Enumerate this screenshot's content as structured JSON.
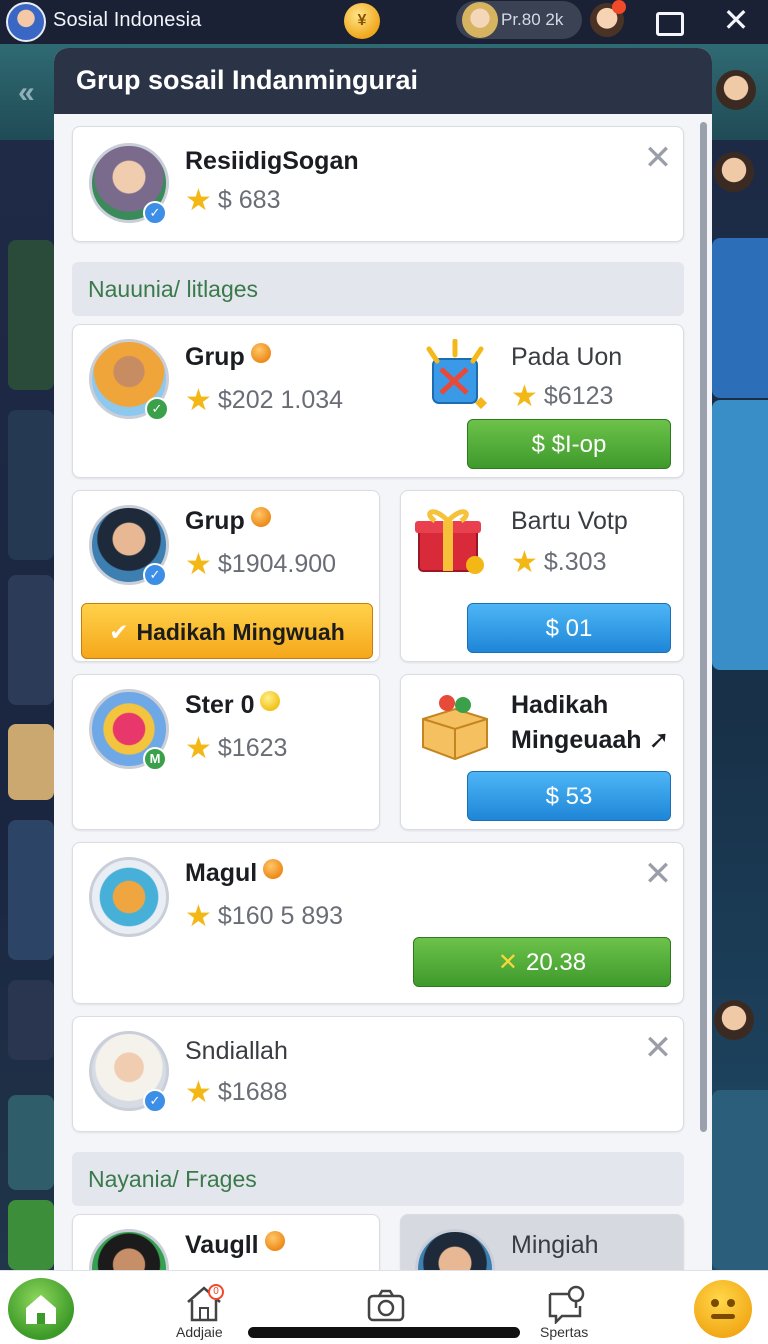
{
  "topbar": {
    "app_title": "Sosial Indonesia",
    "profile_pill_text": "Pr.80 2k"
  },
  "modal": {
    "title": "Grup sosail Indanmingurai"
  },
  "featured": {
    "name": "ResiidigSogan",
    "value": "$ 683"
  },
  "sections": {
    "first": "Nauunia/ litlages",
    "second": "Nayania/ Frages"
  },
  "cards": {
    "grup1": {
      "name": "Grup",
      "value": "$202 1.034"
    },
    "pada": {
      "name": "Pada Uon",
      "value": "$6123",
      "button": "$ $I-op"
    },
    "grup2": {
      "name": "Grup",
      "value": "$1904.900",
      "button": "Hadikah Mingwuah"
    },
    "gartu": {
      "name": "Bartu Votp",
      "value": "$.303",
      "button": "$ 01"
    },
    "ster": {
      "name": "Ster 0",
      "value": "$1623"
    },
    "hadikah": {
      "name_line1": "Hadikah",
      "name_line2": "Mingeuaah",
      "button": "$ 53"
    },
    "magul": {
      "name": "Magul",
      "value": "$160 5 893",
      "button": "20.38"
    },
    "sndiallah": {
      "name": "Sndiallah",
      "value": "$1688"
    },
    "vaugll": {
      "name": "Vaugll"
    },
    "mingiah": {
      "name": "Mingiah"
    }
  },
  "bottom_nav": {
    "add_label": "Addjaie",
    "sport_label": "Spertas",
    "add_badge": "0"
  },
  "colors": {
    "accent_green": "#3f9a2c",
    "accent_blue": "#1f86d8",
    "accent_orange": "#f5a71b",
    "header_dark": "#2b3347"
  },
  "icons": [
    "star-icon",
    "close-icon",
    "home-icon",
    "camera-icon",
    "chat-pin-icon",
    "emoji-icon",
    "window-icon",
    "coin-icon"
  ]
}
